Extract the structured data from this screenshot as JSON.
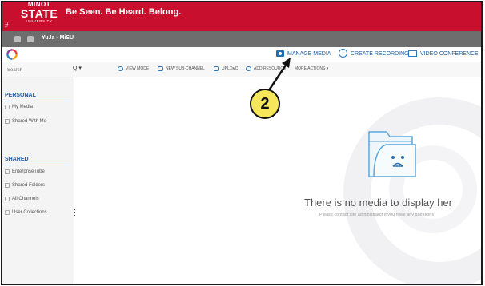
{
  "banner": {
    "logo_line1": "MINOT",
    "logo_line2": "STATE",
    "logo_line3": "UNIVERSITY",
    "tagline": "Be Seen. Be Heard. Belong.",
    "hash": "#",
    "color": "#c8102e"
  },
  "tab": {
    "title": "YuJa - MiSU"
  },
  "appbar": {
    "logo_icon": "yuja-swirl-icon",
    "manage_media": "MANAGE MEDIA",
    "create_recording": "CREATE RECORDING",
    "video_conference": "VIDEO CONFERENCE",
    "accent": "#1e5b9a"
  },
  "toolbar": {
    "search_placeholder": "Search",
    "search_button": "Q ▾",
    "view_mode": "VIEW MODE",
    "new_sub_channel": "NEW SUB-CHANNEL",
    "upload": "UPLOAD",
    "add_resource": "ADD RESOURCE",
    "more_actions": "MORE ACTIONS ▾"
  },
  "sidebar": {
    "personal_heading": "PERSONAL",
    "personal_items": [
      "My Media",
      "Shared With Me"
    ],
    "shared_heading": "SHARED",
    "shared_items": [
      "EnterpriseTube",
      "Shared Folders",
      "All Channels",
      "User Collections"
    ]
  },
  "main": {
    "empty_title": "There is no media to display her",
    "empty_subtitle": "Please contact site administrator if you have any questions",
    "empty_icon": "sad-folder-icon"
  },
  "annotation": {
    "label": "2",
    "color": "#f6e65c"
  }
}
